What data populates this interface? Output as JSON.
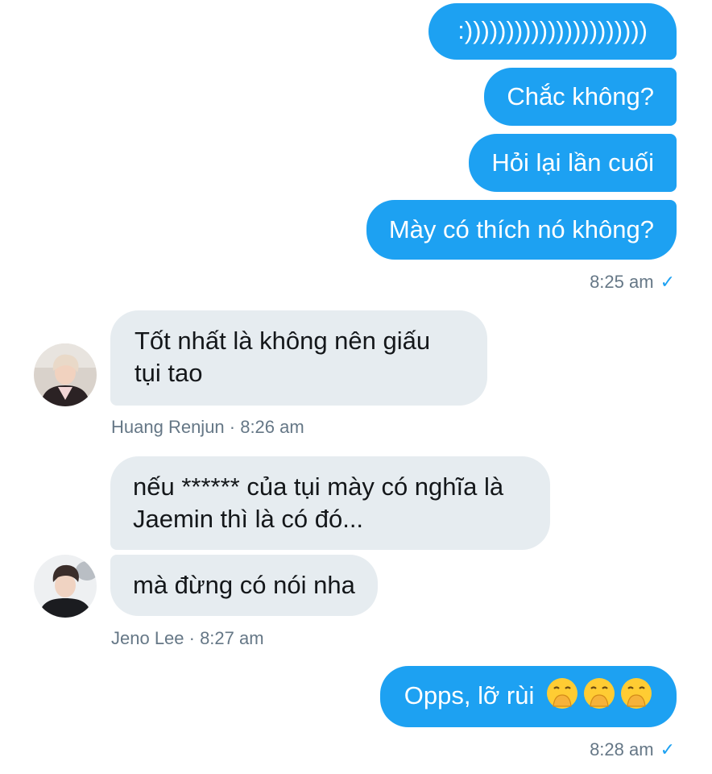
{
  "outgoing_1": {
    "messages": [
      ":))))))))))))))))))))))",
      "Chắc không?",
      "Hỏi lại lần cuối",
      "Mày có thích nó không?"
    ],
    "time": "8:25 am"
  },
  "incoming_1": {
    "sender": "Huang Renjun",
    "time": "8:26 am",
    "meta": "Huang Renjun · 8:26 am",
    "messages": [
      "Tốt nhất là không nên giấu tụi tao"
    ]
  },
  "incoming_2": {
    "sender": "Jeno Lee",
    "time": "8:27 am",
    "meta": "Jeno Lee · 8:27 am",
    "messages": [
      "nếu ****** của tụi mày có nghĩa là Jaemin thì là có đó...",
      "mà đừng có nói nha"
    ]
  },
  "outgoing_2": {
    "text": "Opps, lỡ rùi",
    "emoji": [
      "hand-over-mouth-emoji",
      "hand-over-mouth-emoji",
      "hand-over-mouth-emoji"
    ],
    "time": "8:28 am"
  },
  "icons": {
    "read_receipt": "checkmark-icon"
  },
  "colors": {
    "outgoing_bubble": "#1DA1F2",
    "incoming_bubble": "#E6ECF0",
    "meta_text": "#657786"
  }
}
